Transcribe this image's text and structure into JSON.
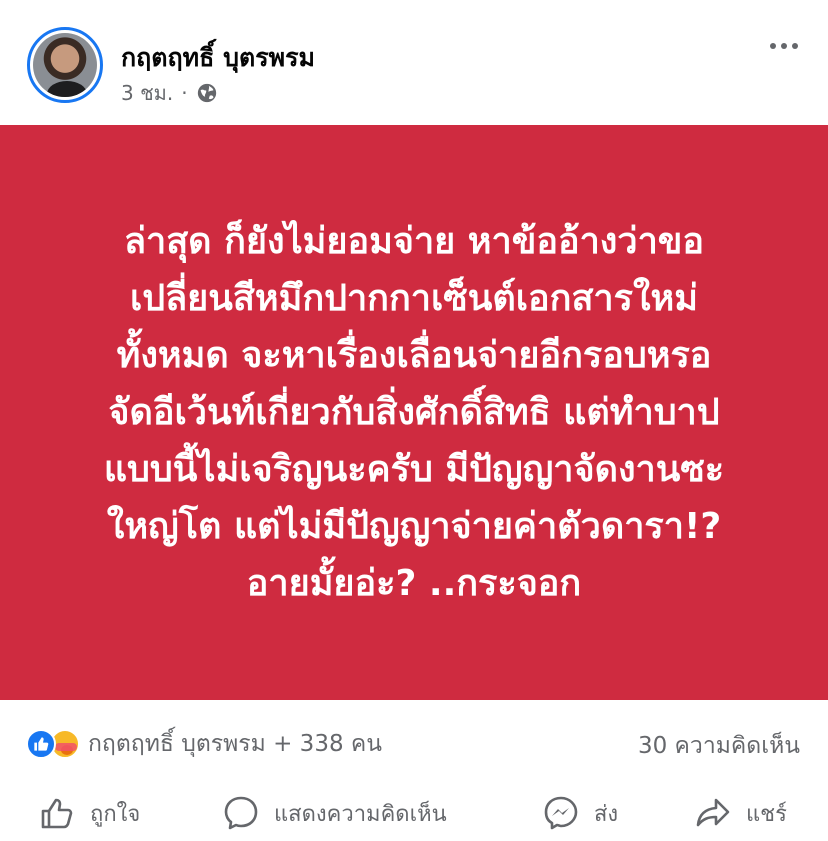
{
  "post": {
    "author": "กฤตฤทธิ์ บุตรพรม",
    "time": "3 ชม.",
    "separator": "·",
    "privacy_icon": "globe-icon",
    "more_icon": "more-options-icon",
    "background_color": "#cf2b40",
    "text_lines": [
      "ล่าสุด ก็ยังไม่ยอมจ่าย หาข้ออ้างว่าขอ",
      "เปลี่ยนสีหมึกปากกาเซ็นต์เอกสารใหม่",
      "ทั้งหมด จะหาเรื่องเลื่อนจ่ายอีกรอบหรอ",
      "จัดอีเว้นท์เกี่ยวกับสิ่งศักดิ์สิทธิ แต่ทำบาป",
      "แบบนี้ไม่เจริญนะครับ มีปัญญาจัดงานซะ",
      "ใหญ่โต แต่ไม่มีปัญญาจ่ายค่าตัวดารา!?",
      "อายมั้ยอ่ะ? ..กระจอก"
    ]
  },
  "stats": {
    "reactions": [
      "like-icon",
      "care-icon"
    ],
    "reactors": "กฤตฤทธิ์ บุตรพรม + 338 คน",
    "comments": "30 ความคิดเห็น"
  },
  "actions": {
    "like": "ถูกใจ",
    "comment": "แสดงความคิดเห็น",
    "send": "ส่ง",
    "share": "แชร์"
  },
  "colors": {
    "accent": "#1877f2",
    "secondary_text": "#65676b"
  }
}
